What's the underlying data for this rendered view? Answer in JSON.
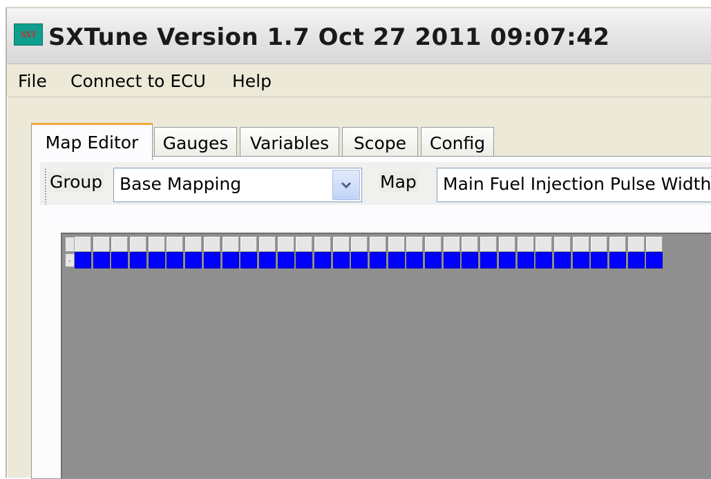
{
  "window": {
    "title": "SXTune Version 1.7 Oct 27 2011 09:07:42",
    "logo_text": "SXT"
  },
  "menu": {
    "items": [
      {
        "label": "File"
      },
      {
        "label": "Connect to ECU"
      },
      {
        "label": "Help"
      }
    ]
  },
  "tabs": [
    {
      "label": "Map Editor",
      "active": true
    },
    {
      "label": "Gauges",
      "active": false
    },
    {
      "label": "Variables",
      "active": false
    },
    {
      "label": "Scope",
      "active": false
    },
    {
      "label": "Config",
      "active": false
    }
  ],
  "toolbar": {
    "group_label": "Group",
    "group_value": "Base Mapping",
    "map_label": "Map",
    "map_value": "Main Fuel Injection Pulse Width"
  },
  "grid": {
    "columns": 32,
    "rows": 1,
    "cell_color": "#0000ff",
    "background": "#8f8f90"
  }
}
